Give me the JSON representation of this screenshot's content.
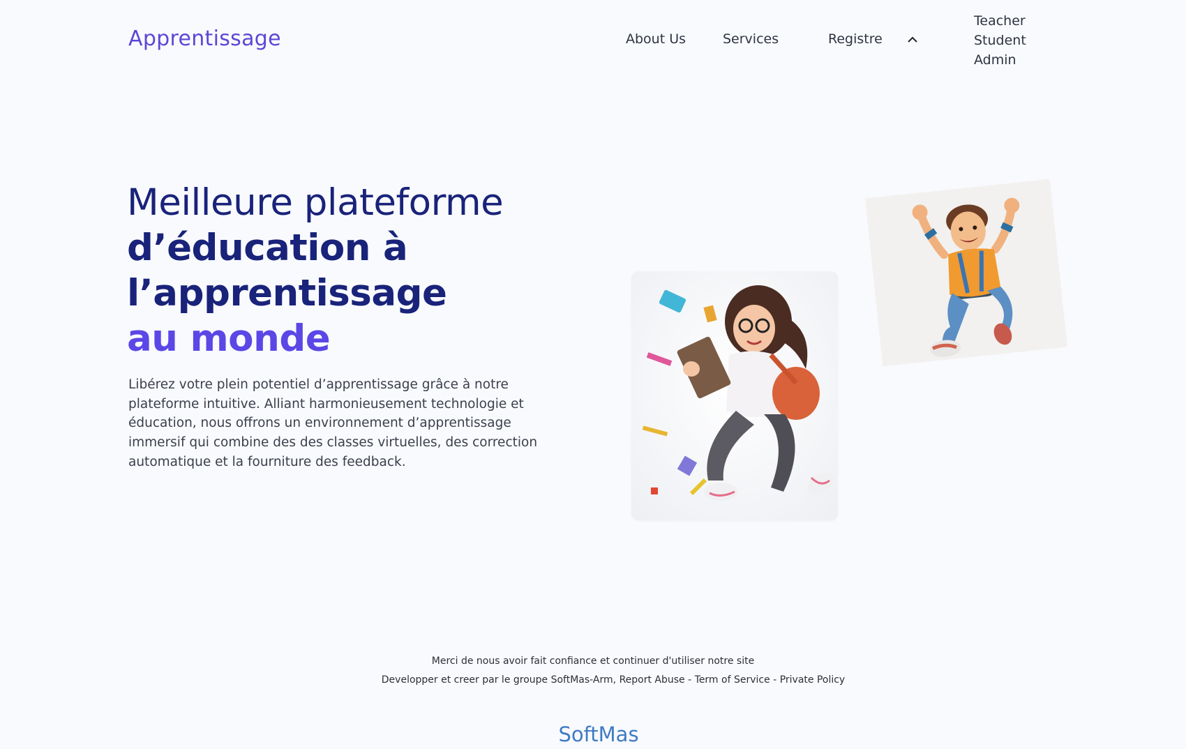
{
  "header": {
    "logo": "Apprentissage",
    "nav": {
      "about": "About Us",
      "services": "Services",
      "register": "Registre"
    },
    "dropdown": [
      "Teacher",
      "Student",
      "Admin"
    ]
  },
  "hero": {
    "title_line1": "Meilleure plateforme",
    "title_line2": "d’éducation à",
    "title_line3": "l’apprentissage",
    "title_line4": "au monde",
    "description": "Libérez votre plein potentiel d’apprentissage grâce à notre plateforme intuitive. Alliant harmonieusement technologie et éducation, nous offrons un environnement d’apprentissage immersif qui combine des des classes virtuelles, des correction automatique et la fourniture des feedback."
  },
  "footer": {
    "thanks": "Merci de nous avoir fait confiance et continuer d'utiliser notre site",
    "credits": "Developper et creer par le groupe SoftMas-Arm,",
    "report": "Report Abuse",
    "sep": "-",
    "terms": "Term of Service",
    "privacy": "Private Policy",
    "brand": "SoftMas"
  },
  "colors": {
    "accent": "#5b47e6",
    "title": "#19237a",
    "brand": "#3f7bc4",
    "background": "#f9fafe"
  }
}
